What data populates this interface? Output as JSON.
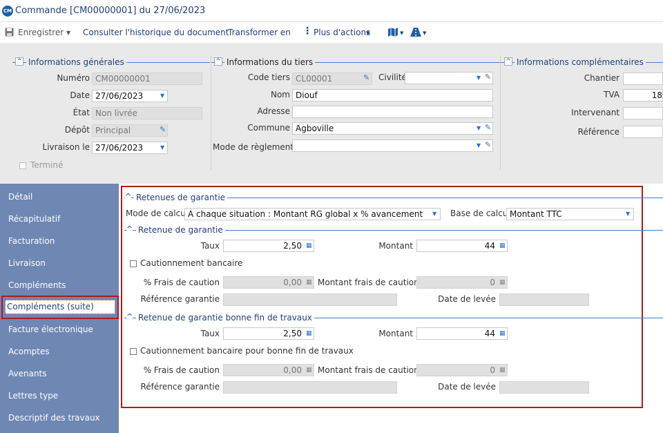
{
  "window": {
    "app_icon": "CM",
    "title": "Commande [CM00000001] du 27/06/2023"
  },
  "toolbar": {
    "save_label": "Enregistrer",
    "history_label": "Consulter l'historique du document",
    "transform_label": "Transformer en",
    "more_actions_label": "Plus d'actions"
  },
  "general": {
    "title": "Informations générales",
    "numero_label": "Numéro",
    "numero_value": "CM00000001",
    "date_label": "Date",
    "date_value": "27/06/2023",
    "etat_label": "État",
    "etat_value": "Non livrée",
    "depot_label": "Dépôt",
    "depot_value": "Principal",
    "livraison_label": "Livraison le",
    "livraison_value": "27/06/2023",
    "termine_label": "Terminé"
  },
  "tiers": {
    "title": "Informations du tiers",
    "code_label": "Code tiers",
    "code_value": "CL00001",
    "civilite_label": "Civilité",
    "civilite_value": "",
    "nom_label": "Nom",
    "nom_value": "Diouf",
    "adresse_label": "Adresse",
    "adresse_value": "",
    "commune_label": "Commune",
    "commune_value": "Agboville",
    "reglement_label": "Mode de règlement",
    "reglement_value": ""
  },
  "complementaires": {
    "title": "Informations complémentaires",
    "chantier_label": "Chantier",
    "chantier_value": "",
    "tva_label": "TVA",
    "tva_value": "18",
    "intervenant_label": "Intervenant",
    "intervenant_value": "",
    "reference_label": "Référence",
    "reference_value": ""
  },
  "sidebar": {
    "items": [
      {
        "label": "Détail"
      },
      {
        "label": "Récapitulatif"
      },
      {
        "label": "Facturation"
      },
      {
        "label": "Livraison"
      },
      {
        "label": "Compléments"
      },
      {
        "label": "Compléments (suite)"
      },
      {
        "label": "Facture électronique"
      },
      {
        "label": "Acomptes"
      },
      {
        "label": "Avenants"
      },
      {
        "label": "Lettres type"
      },
      {
        "label": "Descriptif des travaux"
      }
    ],
    "selected_index": 5
  },
  "retenues": {
    "title": "Retenues de garantie",
    "mode_label": "Mode de calcul",
    "mode_value": "A chaque situation : Montant RG global x % avancement",
    "base_label": "Base de calcul",
    "base_value": "Montant TTC"
  },
  "retenue": {
    "title": "Retenue de garantie",
    "taux_label": "Taux",
    "taux_value": "2,50",
    "montant_label": "Montant",
    "montant_value": "44",
    "caution_label": "Cautionnement bancaire",
    "frais_label": "% Frais de caution",
    "frais_value": "0,00",
    "montant_frais_label": "Montant frais de caution",
    "montant_frais_value": "0",
    "reference_label": "Référence garantie",
    "reference_value": "",
    "levee_label": "Date de levée",
    "levee_value": ""
  },
  "bonne_fin": {
    "title": "Retenue de garantie bonne fin de travaux",
    "taux_label": "Taux",
    "taux_value": "2,50",
    "montant_label": "Montant",
    "montant_value": "44",
    "caution_label": "Cautionnement bancaire pour bonne fin de travaux",
    "frais_label": "% Frais de caution",
    "frais_value": "0,00",
    "montant_frais_label": "Montant frais de caution",
    "montant_frais_value": "0",
    "reference_label": "Référence garantie",
    "reference_value": "",
    "levee_label": "Date de levée",
    "levee_value": ""
  },
  "colors": {
    "sidebar_bg": "#6e87b3",
    "header_bg": "#e9e9e9",
    "accent": "#1f3f7a",
    "highlight_border": "#b01a1a"
  }
}
